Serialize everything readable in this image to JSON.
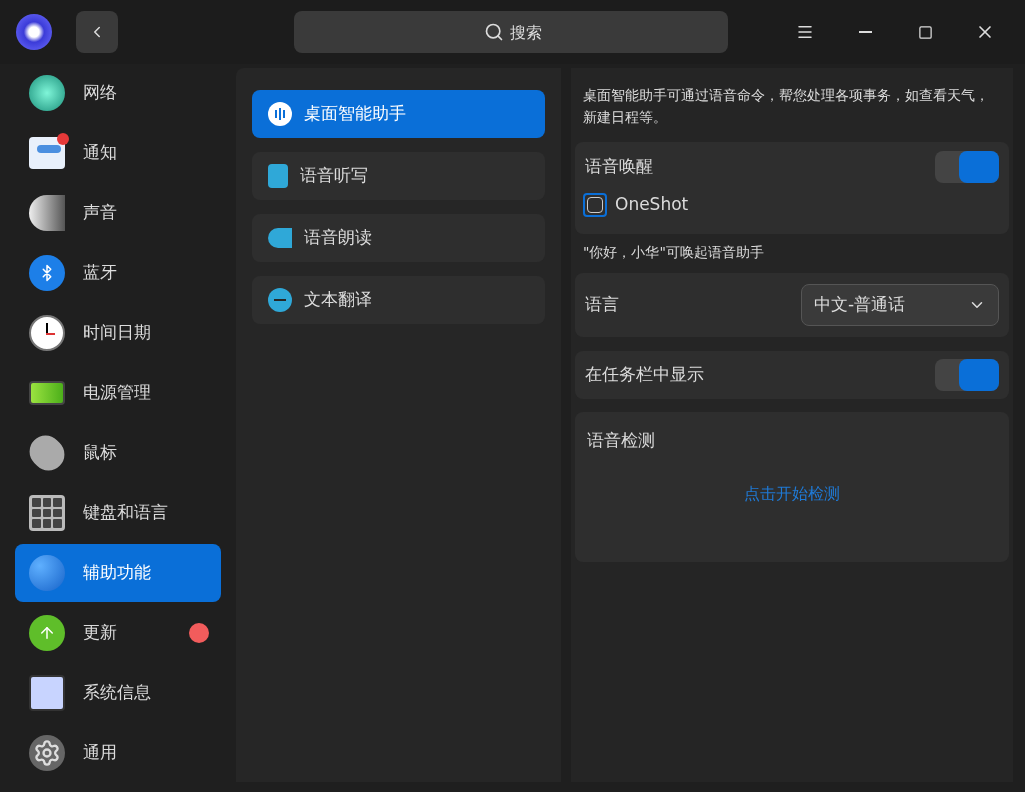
{
  "titlebar": {
    "search": {
      "placeholder": "搜索"
    }
  },
  "sidebar": {
    "items": [
      {
        "label": "网络",
        "selected": false,
        "notification_dot": false
      },
      {
        "label": "通知",
        "selected": false,
        "notification_dot": false
      },
      {
        "label": "声音",
        "selected": false,
        "notification_dot": false
      },
      {
        "label": "蓝牙",
        "selected": false,
        "notification_dot": false
      },
      {
        "label": "时间日期",
        "selected": false,
        "notification_dot": false
      },
      {
        "label": "电源管理",
        "selected": false,
        "notification_dot": false
      },
      {
        "label": "鼠标",
        "selected": false,
        "notification_dot": false
      },
      {
        "label": "键盘和语言",
        "selected": false,
        "notification_dot": false
      },
      {
        "label": "辅助功能",
        "selected": true,
        "notification_dot": false
      },
      {
        "label": "更新",
        "selected": false,
        "notification_dot": true
      },
      {
        "label": "系统信息",
        "selected": false,
        "notification_dot": false
      },
      {
        "label": "通用",
        "selected": false,
        "notification_dot": false
      }
    ]
  },
  "subnav": {
    "items": [
      {
        "label": "桌面智能助手",
        "selected": true
      },
      {
        "label": "语音听写",
        "selected": false
      },
      {
        "label": "语音朗读",
        "selected": false
      },
      {
        "label": "文本翻译",
        "selected": false
      }
    ]
  },
  "content": {
    "description": "桌面智能助手可通过语音命令，帮您处理各项事务，如查看天气，新建日程等。",
    "voice_wakeup": {
      "label": "语音唤醒",
      "on": true,
      "oneshot": {
        "label": "OneShot",
        "checked": false
      }
    },
    "wakeup_hint": "\"你好，小华\"可唤起语音助手",
    "language": {
      "label": "语言",
      "value": "中文-普通话"
    },
    "show_in_taskbar": {
      "label": "在任务栏中显示",
      "on": true
    },
    "voice_test": {
      "title": "语音检测",
      "link": "点击开始检测"
    }
  }
}
